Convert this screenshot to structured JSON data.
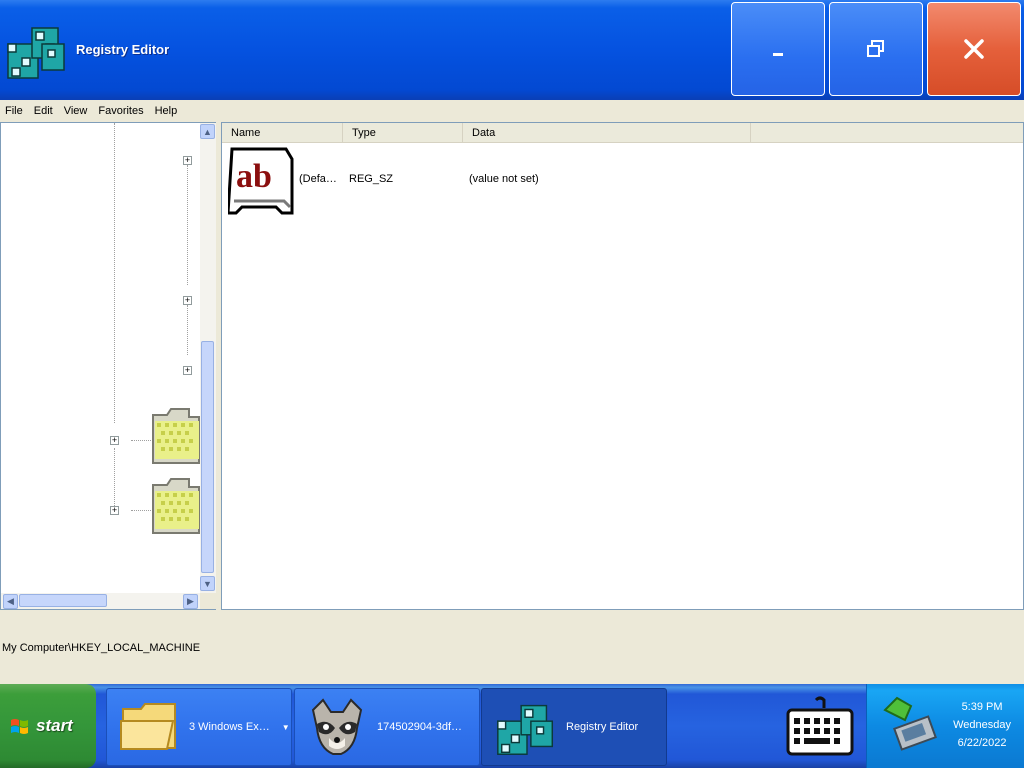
{
  "window": {
    "title": "Registry Editor",
    "icon": "registry-editor-icon"
  },
  "menu": [
    "File",
    "Edit",
    "View",
    "Favorites",
    "Help"
  ],
  "list": {
    "columns": [
      "Name",
      "Type",
      "Data"
    ],
    "rows": [
      {
        "name": "(Defa…",
        "type": "REG_SZ",
        "data": "(value not set)",
        "icon": "string-value-icon"
      }
    ]
  },
  "statusbar": {
    "path": "My Computer\\HKEY_LOCAL_MACHINE"
  },
  "taskbar": {
    "start_label": "start",
    "tasks": [
      {
        "label": "3 Windows Ex…",
        "icon": "folder-icon"
      },
      {
        "label": "174502904-3df…",
        "icon": "raccoon-icon"
      },
      {
        "label": "Registry Editor",
        "icon": "registry-editor-icon"
      }
    ],
    "clock": {
      "time": "5:39 PM",
      "day": "Wednesday",
      "date": "6/22/2022"
    }
  },
  "colors": {
    "titlebar": "#0552e0",
    "close_button": "#e5603b",
    "start_button": "#3c9e3a",
    "tray": "#0d8ae3"
  }
}
